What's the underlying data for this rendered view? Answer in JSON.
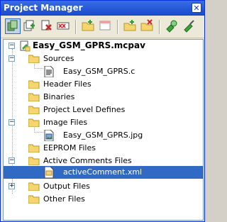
{
  "window": {
    "title": "Project Manager",
    "close_symbol": "✕"
  },
  "toolbar": {
    "buttons": [
      {
        "name": "copy-icon"
      },
      {
        "name": "add-files-icon"
      },
      {
        "name": "remove-file-icon"
      },
      {
        "name": "remove-all-icon"
      },
      {
        "name": "new-folder-icon"
      },
      {
        "name": "window-icon"
      },
      {
        "name": "open-folder-icon"
      },
      {
        "name": "close-folder-icon"
      },
      {
        "name": "build-icon"
      },
      {
        "name": "clean-icon"
      }
    ]
  },
  "tree": {
    "project": "Easy_GSM_GPRS.mcpav",
    "nodes": [
      {
        "label": "Sources",
        "type": "folder",
        "expanded": true
      },
      {
        "label": "Easy_GSM_GPRS.c",
        "type": "c-file"
      },
      {
        "label": "Header Files",
        "type": "folder"
      },
      {
        "label": "Binaries",
        "type": "folder"
      },
      {
        "label": "Project Level Defines",
        "type": "folder"
      },
      {
        "label": "Image Files",
        "type": "folder",
        "expanded": true
      },
      {
        "label": "Easy_GSM_GPRS.jpg",
        "type": "image-file"
      },
      {
        "label": "EEPROM Files",
        "type": "folder"
      },
      {
        "label": "Active Comments Files",
        "type": "folder",
        "expanded": true
      },
      {
        "label": "activeComment.xml",
        "type": "xml-file",
        "selected": true
      },
      {
        "label": "Output Files",
        "type": "folder",
        "expandable": true
      },
      {
        "label": "Other Files",
        "type": "folder"
      }
    ]
  },
  "colors": {
    "titlebar": "#2357d8",
    "selection": "#316ac5",
    "folder": "#f5d56f"
  }
}
